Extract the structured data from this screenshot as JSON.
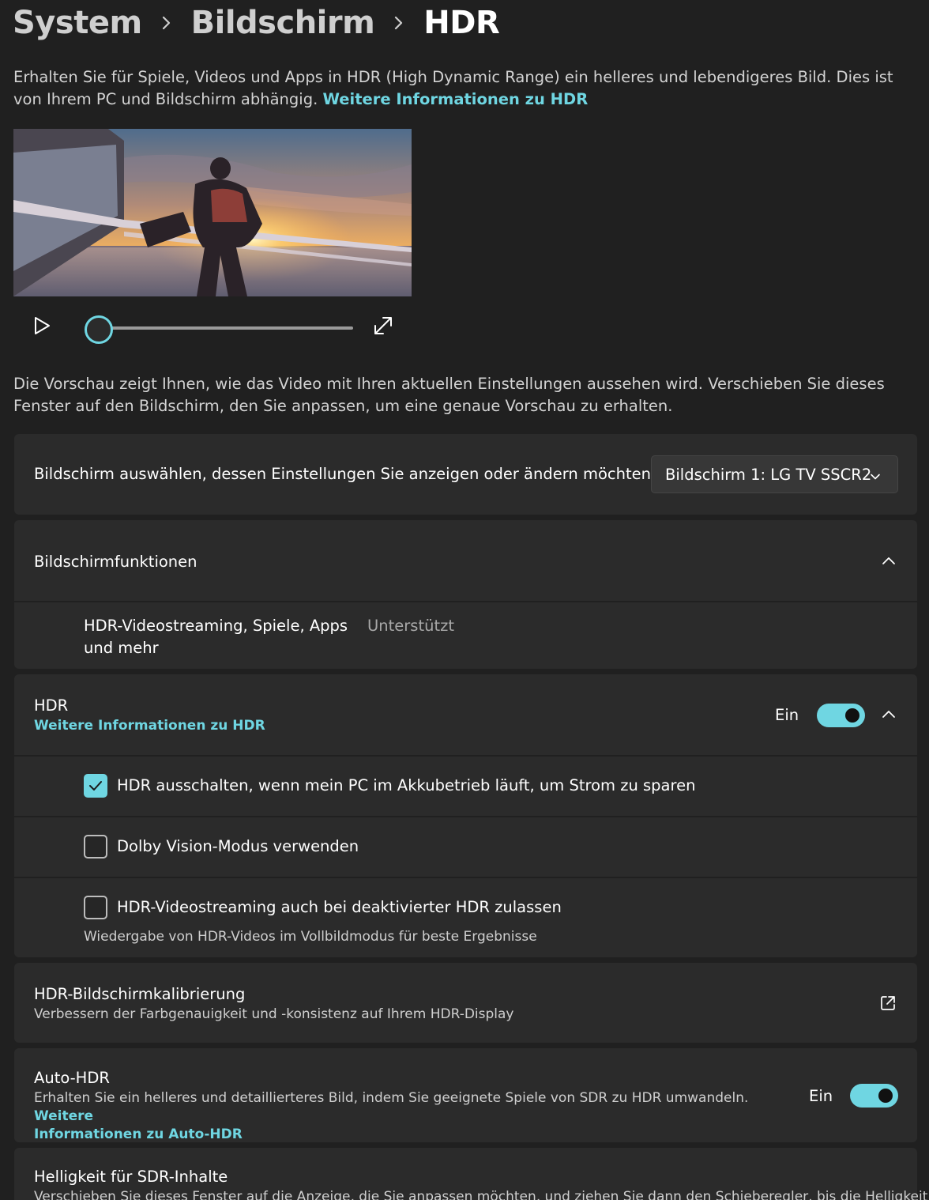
{
  "breadcrumb": {
    "items": [
      "System",
      "Bildschirm",
      "HDR"
    ]
  },
  "intro": {
    "text": "Erhalten Sie für Spiele, Videos und Apps in HDR (High Dynamic Range) ein helleres und lebendigeres Bild. Dies ist von Ihrem PC und Bildschirm abhängig. ",
    "link": "Weitere Informationen zu HDR"
  },
  "preview": {
    "note": "Die Vorschau zeigt Ihnen, wie das Video mit Ihren aktuellen Einstellungen aussehen wird. Verschieben Sie dieses Fenster auf den Bildschirm, den Sie anpassen, um eine genaue Vorschau zu erhalten.",
    "progress": 0
  },
  "display_select": {
    "label": "Bildschirm auswählen, dessen Einstellungen Sie anzeigen oder ändern möchten",
    "value": "Bildschirm 1: LG TV SSCR2"
  },
  "capabilities": {
    "title": "Bildschirmfunktionen",
    "item_label_line1": "HDR-Videostreaming, Spiele, Apps",
    "item_label_line2": "und mehr",
    "item_value": "Unterstützt"
  },
  "hdr": {
    "title": "HDR",
    "link": "Weitere Informationen zu HDR",
    "toggle_label": "Ein",
    "enabled": true,
    "options": [
      {
        "label": "HDR ausschalten, wenn mein PC im Akkubetrieb läuft, um Strom zu sparen",
        "checked": true
      },
      {
        "label": "Dolby Vision-Modus verwenden",
        "checked": false
      },
      {
        "label": "HDR-Videostreaming auch bei deaktivierter HDR zulassen",
        "checked": false,
        "description": "Wiedergabe von HDR-Videos im Vollbildmodus für beste Ergebnisse"
      }
    ]
  },
  "calibration": {
    "title": "HDR-Bildschirmkalibrierung",
    "description": "Verbessern der Farbgenauigkeit und -konsistenz auf Ihrem HDR-Display"
  },
  "auto_hdr": {
    "title": "Auto-HDR",
    "description": "Erhalten Sie ein helleres und detaillierteres Bild, indem Sie geeignete Spiele von SDR zu HDR umwandeln. ",
    "link_line1": "Weitere",
    "link_line2": "Informationen zu Auto-HDR",
    "toggle_label": "Ein",
    "enabled": true
  },
  "sdr_brightness": {
    "title": "Helligkeit für SDR-Inhalte",
    "description": "Verschieben Sie dieses Fenster auf die Anzeige, die Sie anpassen möchten, und ziehen Sie dann den Schieberegler, bis die Helligkeit"
  },
  "colors": {
    "accent": "#6fd6e2",
    "background": "#202020",
    "card": "#2b2b2b"
  },
  "icons": {
    "play": "play-icon",
    "expand": "expand-icon",
    "chevron_down": "chevron-down-icon",
    "chevron_up": "chevron-up-icon",
    "external": "external-link-icon",
    "check": "checkmark-icon"
  }
}
